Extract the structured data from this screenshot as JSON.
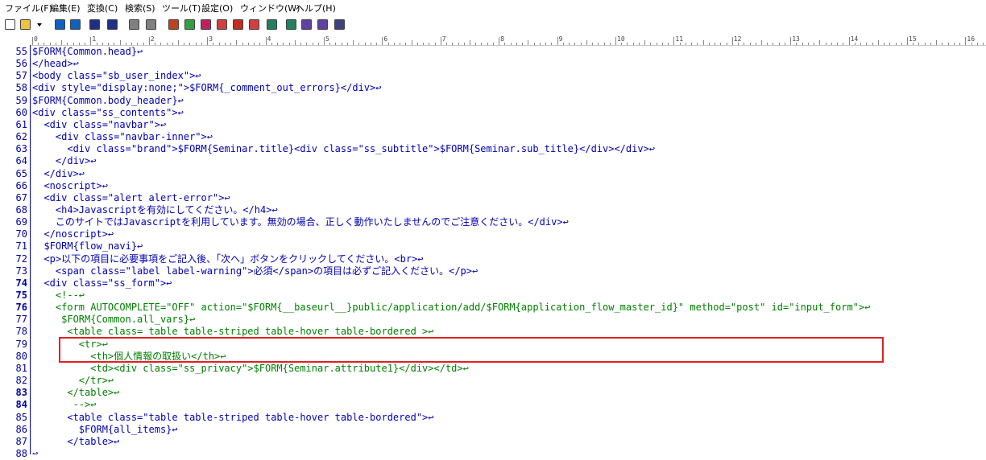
{
  "menu": [
    "ファイル(F)",
    "編集(E)",
    "変換(C)",
    "検索(S)",
    "ツール(T)",
    "設定(O)",
    "ウィンドウ(W)",
    "ヘルプ(H)"
  ],
  "toolbar_icons": [
    "new-file-icon",
    "open-file-icon",
    "dropdown-arrow-icon",
    "save-icon",
    "save-all-icon",
    "undo-icon",
    "redo-icon",
    "indent-left-icon",
    "indent-right-icon",
    "find-icon",
    "find-next-icon",
    "find-prev-icon",
    "replace-icon",
    "grep-icon",
    "bookmark-icon",
    "tag-jump-icon",
    "compare-icon",
    "outline-icon",
    "macro-icon",
    "settings-icon"
  ],
  "ruler": [
    "0",
    "1",
    "2",
    "3",
    "4",
    "5",
    "6",
    "7",
    "8",
    "9",
    "10",
    "11",
    "12",
    "13",
    "14",
    "15",
    "16"
  ],
  "lines": [
    {
      "no": "55",
      "text": "$FORM{Common.head}↩",
      "type": "code"
    },
    {
      "no": "56",
      "text": "</head>↩",
      "type": "code"
    },
    {
      "no": "57",
      "text": "<body class=\"sb_user_index\">↩",
      "type": "code"
    },
    {
      "no": "58",
      "text": "<div style=\"display:none;\">$FORM{_comment_out_errors}</div>↩",
      "type": "code"
    },
    {
      "no": "59",
      "text": "$FORM{Common.body_header}↩",
      "type": "code"
    },
    {
      "no": "60",
      "text": "<div class=\"ss_contents\">↩",
      "type": "code"
    },
    {
      "no": "61",
      "text": "  <div class=\"navbar\">↩",
      "type": "code"
    },
    {
      "no": "62",
      "text": "    <div class=\"navbar-inner\">↩",
      "type": "code"
    },
    {
      "no": "63",
      "text": "      <div class=\"brand\">$FORM{Seminar.title}<div class=\"ss_subtitle\">$FORM{Seminar.sub_title}</div></div>↩",
      "type": "code"
    },
    {
      "no": "64",
      "text": "    </div>↩",
      "type": "code"
    },
    {
      "no": "65",
      "text": "  </div>↩",
      "type": "code"
    },
    {
      "no": "66",
      "text": "  <noscript>↩",
      "type": "code"
    },
    {
      "no": "67",
      "text": "  <div class=\"alert alert-error\">↩",
      "type": "code"
    },
    {
      "no": "68",
      "text": "    <h4>Javascriptを有効にしてください。</h4>↩",
      "type": "code"
    },
    {
      "no": "69",
      "text": "    このサイトではJavascriptを利用しています。無効の場合、正しく動作いたしませんのでご注意ください。</div>↩",
      "type": "code"
    },
    {
      "no": "70",
      "text": "  </noscript>↩",
      "type": "code"
    },
    {
      "no": "71",
      "text": "  $FORM{flow_navi}↩",
      "type": "code"
    },
    {
      "no": "72",
      "text": "  <p>以下の項目に必要事項をご記入後、「次へ」ボタンをクリックしてください。<br>↩",
      "type": "code"
    },
    {
      "no": "73",
      "text": "    <span class=\"label label-warning\">必須</span>の項目は必ずご記入ください。</p>↩",
      "type": "code"
    },
    {
      "no": "74",
      "text": "  <div class=\"ss_form\">↩",
      "type": "code",
      "bold": true
    },
    {
      "no": "75",
      "text": "    <!--↩",
      "type": "comment",
      "bold": true
    },
    {
      "no": "76",
      "text": "    <form AUTOCOMPLETE=\"OFF\" action=\"$FORM{__baseurl__}public/application/add/$FORM{application_flow_master_id}\" method=\"post\" id=\"input_form\">↩",
      "type": "comment",
      "bold": true
    },
    {
      "no": "77",
      "text": "     $FORM{Common.all_vars}↩",
      "type": "comment"
    },
    {
      "no": "78",
      "text": "      <table class= table table-striped table-hover table-bordered >↩",
      "type": "comment"
    },
    {
      "no": "79",
      "text": "        <tr>↩",
      "type": "comment"
    },
    {
      "no": "80",
      "text": "          <th>個人情報の取扱い</th>↩",
      "type": "comment"
    },
    {
      "no": "81",
      "text": "          <td><div class=\"ss_privacy\">$FORM{Seminar.attribute1}</div></td>↩",
      "type": "comment"
    },
    {
      "no": "82",
      "text": "        </tr>↩",
      "type": "comment"
    },
    {
      "no": "83",
      "text": "      </table>↩",
      "type": "comment",
      "bold": true
    },
    {
      "no": "84",
      "text": "       -->↩",
      "type": "comment",
      "bold": true
    },
    {
      "no": "85",
      "text": "      <table class=\"table table-striped table-hover table-bordered\">↩",
      "type": "code"
    },
    {
      "no": "86",
      "text": "        $FORM{all_items}↩",
      "type": "code"
    },
    {
      "no": "87",
      "text": "      </table>↩",
      "type": "code"
    },
    {
      "no": "88",
      "text": "↩",
      "type": "code"
    }
  ]
}
